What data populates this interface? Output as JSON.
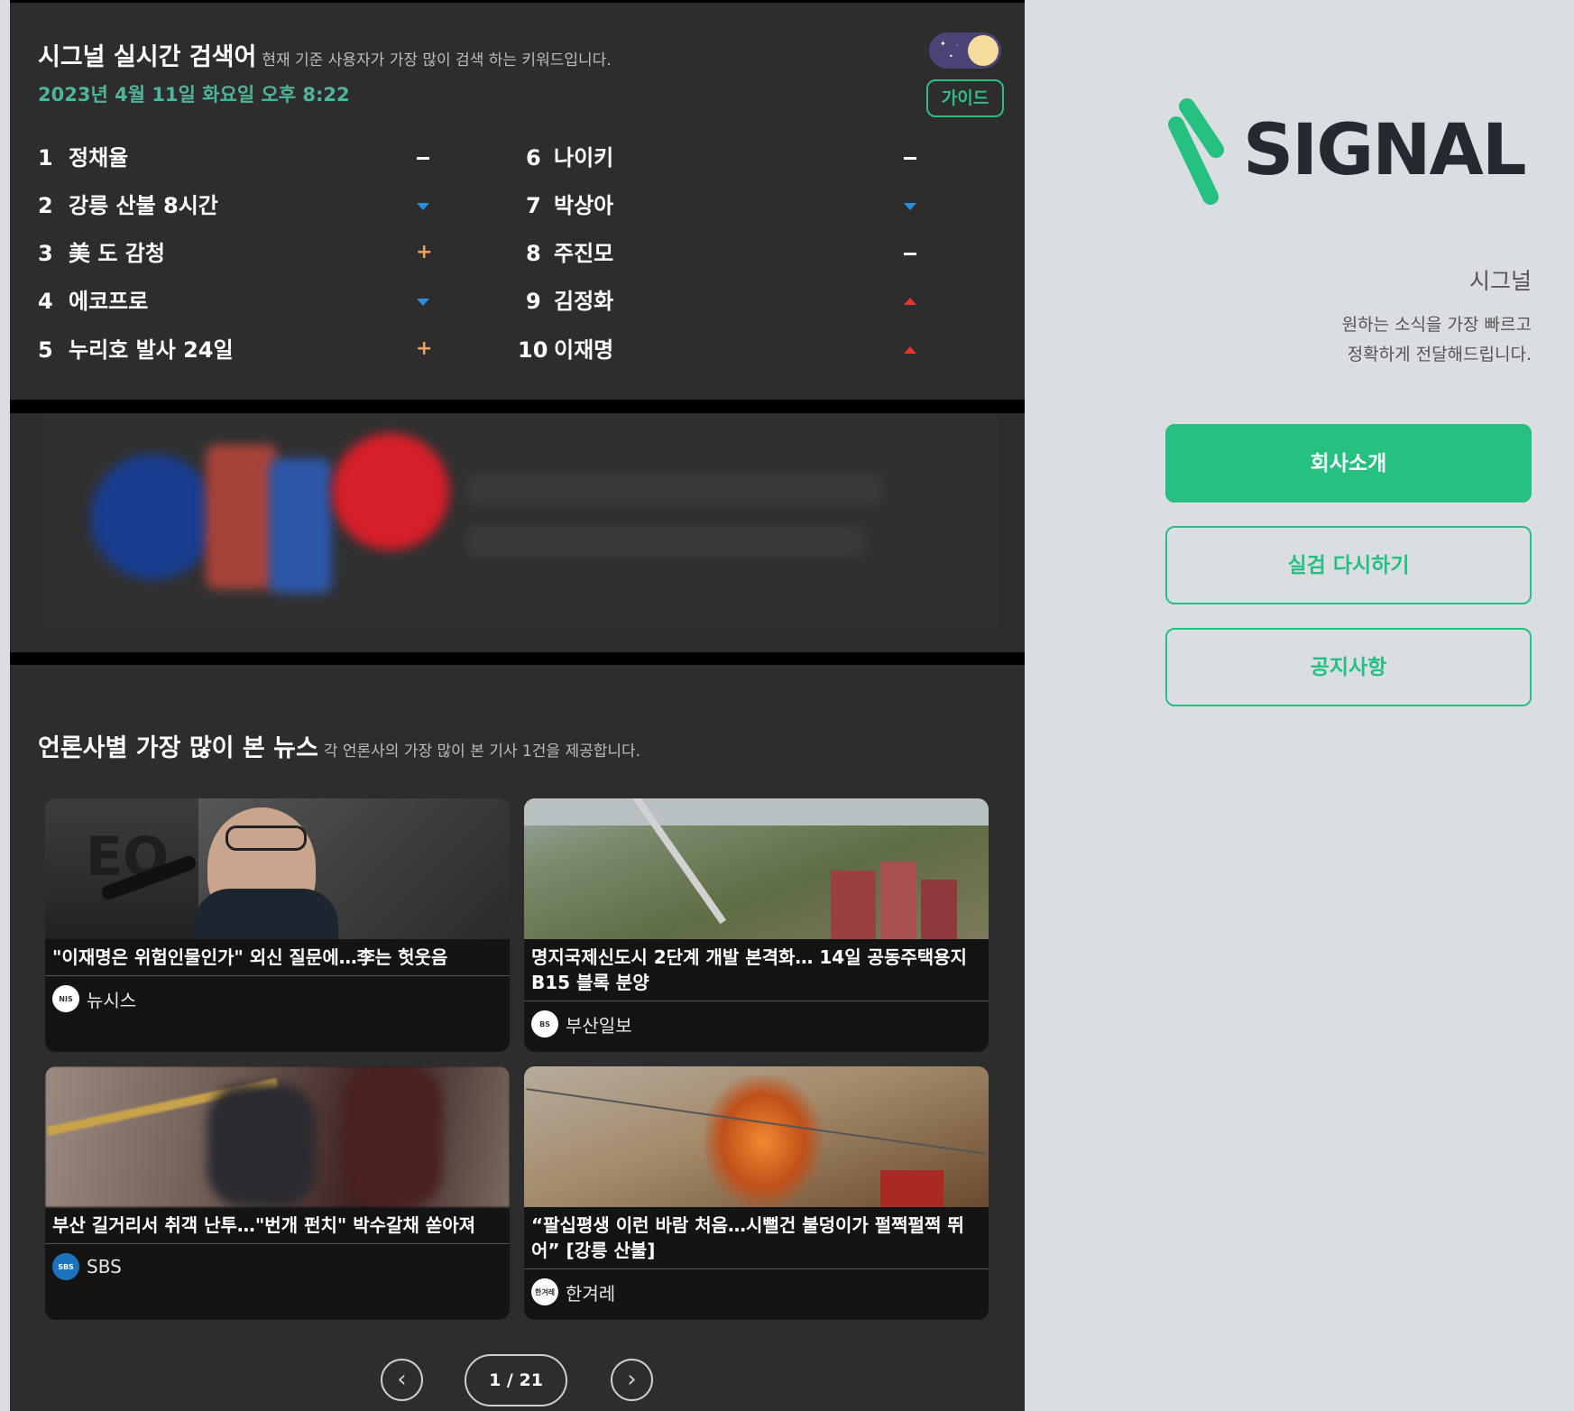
{
  "rank": {
    "title": "시그널 실시간 검색어",
    "subtitle": "현재 기준 사용자가 가장 많이 검색 하는 키워드입니다.",
    "datetime": "2023년 4월 11일 화요일 오후 8:22",
    "guide_label": "가이드",
    "keywords": [
      {
        "rank": "1",
        "text": "정채율",
        "trend": "same"
      },
      {
        "rank": "2",
        "text": "강릉 산불 8시간",
        "trend": "down"
      },
      {
        "rank": "3",
        "text": "美 도 감청",
        "trend": "new"
      },
      {
        "rank": "4",
        "text": "에코프로",
        "trend": "down"
      },
      {
        "rank": "5",
        "text": "누리호 발사 24일",
        "trend": "new"
      },
      {
        "rank": "6",
        "text": "나이키",
        "trend": "same"
      },
      {
        "rank": "7",
        "text": "박상아",
        "trend": "down"
      },
      {
        "rank": "8",
        "text": "주진모",
        "trend": "same"
      },
      {
        "rank": "9",
        "text": "김정화",
        "trend": "up"
      },
      {
        "rank": "10",
        "text": "이재명",
        "trend": "up"
      }
    ]
  },
  "news": {
    "title": "언론사별 가장 많이 본 뉴스",
    "subtitle": "각 언론사의 가장 많이 본 기사 1건을 제공합니다.",
    "cards": [
      {
        "headline": "\"이재명은 위험인물인가\" 외신 질문에…李는 헛웃음",
        "source": "뉴시스"
      },
      {
        "headline": "명지국제신도시 2단계 개발 본격화… 14일 공동주택용지 B15 블록 분양",
        "source": "부산일보"
      },
      {
        "headline": "부산 길거리서 취객 난투…\"번개 펀치\" 박수갈채 쏟아져",
        "source": "SBS"
      },
      {
        "headline": "“팔십평생 이런 바람 처음…시뻘건 불덩이가 펄쩍펄쩍 뛰어” [강릉 산불]",
        "source": "한겨레"
      }
    ],
    "pager": "1 / 21"
  },
  "sidebar": {
    "brand": "SIGNAL",
    "name": "시그널",
    "desc_line1": "원하는 소식을 가장 빠르고",
    "desc_line2": "정확하게 전달해드립니다.",
    "btn_about": "회사소개",
    "btn_retry": "실검 다시하기",
    "btn_notice": "공지사항"
  },
  "colors": {
    "accent": "#26c080",
    "panel": "#2d2d2d",
    "trend_up": "#e8342a",
    "trend_down": "#2b8ed8",
    "trend_new": "#e8a25f"
  }
}
